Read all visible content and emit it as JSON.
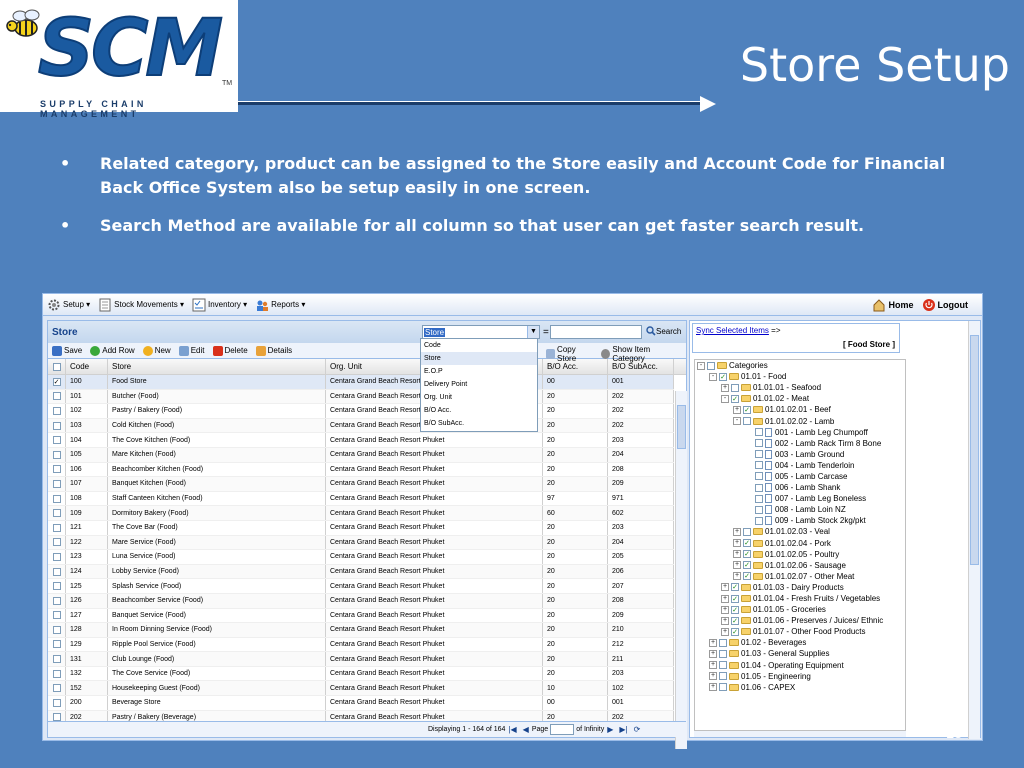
{
  "slide": {
    "title": "Store Setup",
    "logo": "SCM",
    "logo_tm": "TM",
    "logo_subtitle": "SUPPLY CHAIN MANAGEMENT",
    "bullets": [
      "Related category, product can be assigned to the Store easily and Account Code for Financial Back Office System also be setup easily in one screen.",
      "Search Method are available for all column so that user can get faster search result."
    ],
    "bullet_symbol": "•",
    "page_number": "28"
  },
  "menubar": {
    "items": [
      "Setup ▾",
      "Stock Movements ▾",
      "Inventory ▾",
      "Reports ▾"
    ],
    "home": "Home",
    "logout": "Logout"
  },
  "store_panel": {
    "title": "Store",
    "search_field_selected": "Store",
    "search_equals": "=",
    "search_button": "Search",
    "toolbar": [
      "Save",
      "Add Row",
      "New",
      "Edit",
      "Delete",
      "Details"
    ],
    "toolbar_right": [
      "Copy Store",
      "Show Item Category"
    ],
    "dropdown_options": [
      "Code",
      "Store",
      "E.O.P",
      "Delivery Point",
      "Org. Unit",
      "B/O Acc.",
      "B/O SubAcc."
    ],
    "columns": [
      "Code",
      "Store",
      "Org. Unit",
      "B/O Acc.",
      "B/O SubAcc."
    ],
    "rows": [
      [
        "100",
        "Food Store",
        "Centara Grand Beach Resort Phuket",
        "00",
        "001"
      ],
      [
        "101",
        "Butcher (Food)",
        "Centara Grand Beach Resort Phuket",
        "20",
        "202"
      ],
      [
        "102",
        "Pastry / Bakery (Food)",
        "Centara Grand Beach Resort Phuket",
        "20",
        "202"
      ],
      [
        "103",
        "Cold Kitchen (Food)",
        "Centara Grand Beach Resort Phuket",
        "20",
        "202"
      ],
      [
        "104",
        "The Cove Kitchen (Food)",
        "Centara Grand Beach Resort Phuket",
        "20",
        "203"
      ],
      [
        "105",
        "Mare Kitchen (Food)",
        "Centara Grand Beach Resort Phuket",
        "20",
        "204"
      ],
      [
        "106",
        "Beachcomber Kitchen (Food)",
        "Centara Grand Beach Resort Phuket",
        "20",
        "208"
      ],
      [
        "107",
        "Banquet Kitchen (Food)",
        "Centara Grand Beach Resort Phuket",
        "20",
        "209"
      ],
      [
        "108",
        "Staff Canteen Kitchen (Food)",
        "Centara Grand Beach Resort Phuket",
        "97",
        "971"
      ],
      [
        "109",
        "Dormitory Bakery (Food)",
        "Centara Grand Beach Resort Phuket",
        "60",
        "602"
      ],
      [
        "121",
        "The Cove Bar (Food)",
        "Centara Grand Beach Resort Phuket",
        "20",
        "203"
      ],
      [
        "122",
        "Mare Service (Food)",
        "Centara Grand Beach Resort Phuket",
        "20",
        "204"
      ],
      [
        "123",
        "Luna Service (Food)",
        "Centara Grand Beach Resort Phuket",
        "20",
        "205"
      ],
      [
        "124",
        "Lobby Service (Food)",
        "Centara Grand Beach Resort Phuket",
        "20",
        "206"
      ],
      [
        "125",
        "Splash Service (Food)",
        "Centara Grand Beach Resort Phuket",
        "20",
        "207"
      ],
      [
        "126",
        "Beachcomber Service (Food)",
        "Centara Grand Beach Resort Phuket",
        "20",
        "208"
      ],
      [
        "127",
        "Banquet Service (Food)",
        "Centara Grand Beach Resort Phuket",
        "20",
        "209"
      ],
      [
        "128",
        "In Room Dinning Service (Food)",
        "Centara Grand Beach Resort Phuket",
        "20",
        "210"
      ],
      [
        "129",
        "Ripple Pool Service (Food)",
        "Centara Grand Beach Resort Phuket",
        "20",
        "212"
      ],
      [
        "131",
        "Club Lounge (Food)",
        "Centara Grand Beach Resort Phuket",
        "20",
        "211"
      ],
      [
        "132",
        "The Cove Service (Food)",
        "Centara Grand Beach Resort Phuket",
        "20",
        "203"
      ],
      [
        "152",
        "Housekeeping Guest (Food)",
        "Centara Grand Beach Resort Phuket",
        "10",
        "102"
      ],
      [
        "200",
        "Beverage Store",
        "Centara Grand Beach Resort Phuket",
        "00",
        "001"
      ],
      [
        "202",
        "Pastry / Bakery (Beverage)",
        "Centara Grand Beach Resort Phuket",
        "20",
        "202"
      ]
    ],
    "pager": {
      "display": "Displaying 1 - 164 of 164",
      "page_label": "Page",
      "of_label": "of Infinity"
    }
  },
  "category_panel": {
    "sync_link": "Sync Selected Items",
    "sync_arrow": "=>",
    "store_label": "[ Food Store ]",
    "tree": [
      {
        "depth": 0,
        "toggle": "-",
        "check": "",
        "type": "folder",
        "label": "Categories"
      },
      {
        "depth": 1,
        "toggle": "-",
        "check": "✓",
        "type": "folder",
        "label": "01.01 - Food"
      },
      {
        "depth": 2,
        "toggle": "+",
        "check": "",
        "type": "folder",
        "label": "01.01.01 - Seafood"
      },
      {
        "depth": 2,
        "toggle": "-",
        "check": "✓",
        "type": "folder",
        "label": "01.01.02 - Meat"
      },
      {
        "depth": 3,
        "toggle": "+",
        "check": "✓",
        "type": "folder",
        "label": "01.01.02.01 - Beef"
      },
      {
        "depth": 3,
        "toggle": "-",
        "check": "",
        "type": "folder",
        "label": "01.01.02.02 - Lamb"
      },
      {
        "depth": 4,
        "toggle": "",
        "check": "",
        "type": "doc",
        "label": "001 - Lamb Leg Chumpoff"
      },
      {
        "depth": 4,
        "toggle": "",
        "check": "",
        "type": "doc",
        "label": "002 - Lamb Rack Tirm 8 Bone"
      },
      {
        "depth": 4,
        "toggle": "",
        "check": "",
        "type": "doc",
        "label": "003 - Lamb Ground"
      },
      {
        "depth": 4,
        "toggle": "",
        "check": "",
        "type": "doc",
        "label": "004 - Lamb Tenderloin"
      },
      {
        "depth": 4,
        "toggle": "",
        "check": "",
        "type": "doc",
        "label": "005 - Lamb Carcase"
      },
      {
        "depth": 4,
        "toggle": "",
        "check": "",
        "type": "doc",
        "label": "006 - Lamb Shank"
      },
      {
        "depth": 4,
        "toggle": "",
        "check": "",
        "type": "doc",
        "label": "007 - Lamb Leg Boneless"
      },
      {
        "depth": 4,
        "toggle": "",
        "check": "",
        "type": "doc",
        "label": "008 - Lamb Loin NZ"
      },
      {
        "depth": 4,
        "toggle": "",
        "check": "",
        "type": "doc",
        "label": "009 - Lamb Stock 2kg/pkt"
      },
      {
        "depth": 3,
        "toggle": "+",
        "check": "",
        "type": "folder",
        "label": "01.01.02.03 - Veal"
      },
      {
        "depth": 3,
        "toggle": "+",
        "check": "✓",
        "type": "folder",
        "label": "01.01.02.04 - Pork"
      },
      {
        "depth": 3,
        "toggle": "+",
        "check": "✓",
        "type": "folder",
        "label": "01.01.02.05 - Poultry"
      },
      {
        "depth": 3,
        "toggle": "+",
        "check": "✓",
        "type": "folder",
        "label": "01.01.02.06 - Sausage"
      },
      {
        "depth": 3,
        "toggle": "+",
        "check": "✓",
        "type": "folder",
        "label": "01.01.02.07 - Other Meat"
      },
      {
        "depth": 2,
        "toggle": "+",
        "check": "✓",
        "type": "folder",
        "label": "01.01.03 - Dairy Products"
      },
      {
        "depth": 2,
        "toggle": "+",
        "check": "✓",
        "type": "folder",
        "label": "01.01.04 - Fresh Fruits / Vegetables"
      },
      {
        "depth": 2,
        "toggle": "+",
        "check": "✓",
        "type": "folder",
        "label": "01.01.05 - Groceries"
      },
      {
        "depth": 2,
        "toggle": "+",
        "check": "✓",
        "type": "folder",
        "label": "01.01.06 - Preserves / Juices/ Ethnic"
      },
      {
        "depth": 2,
        "toggle": "+",
        "check": "✓",
        "type": "folder",
        "label": "01.01.07 - Other Food Products"
      },
      {
        "depth": 1,
        "toggle": "+",
        "check": "",
        "type": "folder",
        "label": "01.02 - Beverages"
      },
      {
        "depth": 1,
        "toggle": "+",
        "check": "",
        "type": "folder",
        "label": "01.03 - General Supplies"
      },
      {
        "depth": 1,
        "toggle": "+",
        "check": "",
        "type": "folder",
        "label": "01.04 - Operating Equipment"
      },
      {
        "depth": 1,
        "toggle": "+",
        "check": "",
        "type": "folder",
        "label": "01.05 - Engineering"
      },
      {
        "depth": 1,
        "toggle": "+",
        "check": "",
        "type": "folder",
        "label": "01.06 - CAPEX"
      }
    ]
  },
  "colors": {
    "slide_bg": "#4f81bd",
    "panel_border": "#99bbe8",
    "header_blue": "#15428b",
    "logo_blue": "#1a5aa0"
  }
}
